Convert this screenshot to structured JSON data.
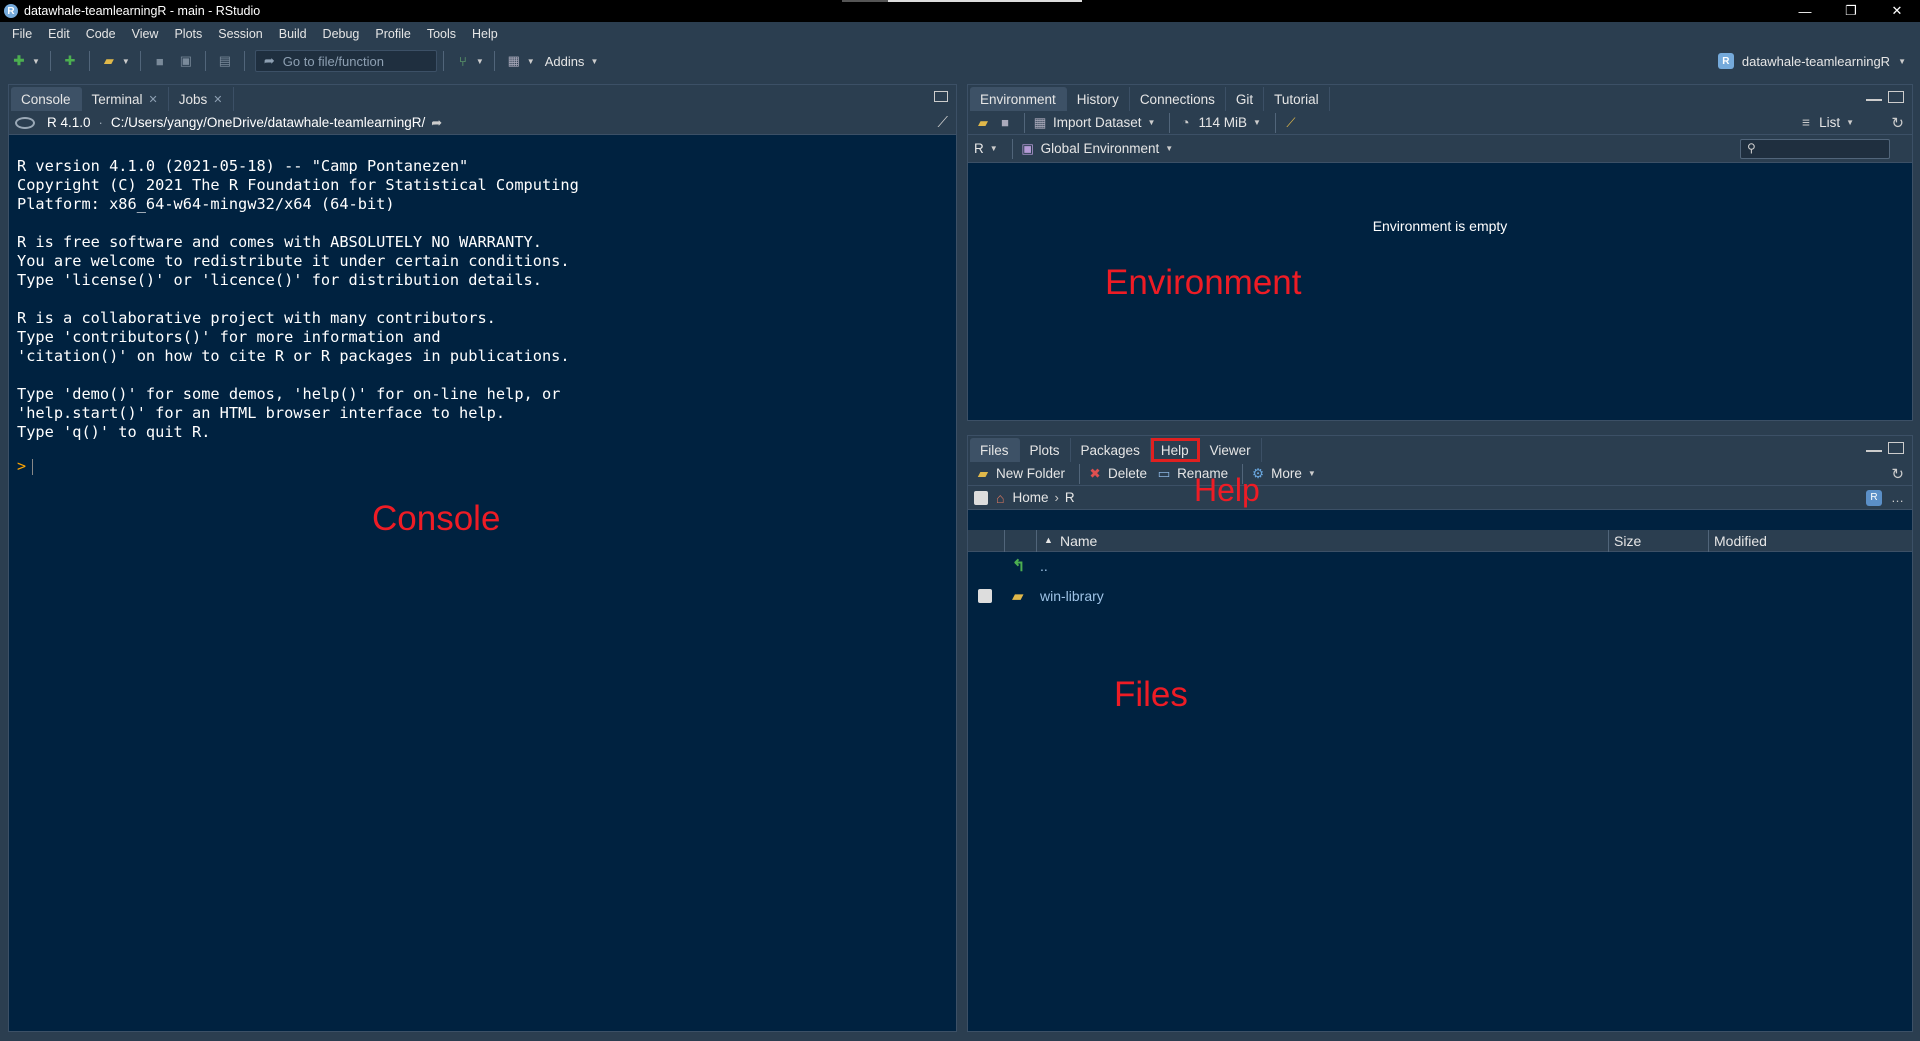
{
  "window": {
    "title": "datawhale-teamlearningR - main - RStudio",
    "controls": [
      "—",
      "❐",
      "✕"
    ]
  },
  "menu": [
    "File",
    "Edit",
    "Code",
    "View",
    "Plots",
    "Session",
    "Build",
    "Debug",
    "Profile",
    "Tools",
    "Help"
  ],
  "toolbar": {
    "goto_placeholder": "Go to file/function",
    "addins_label": "Addins",
    "project_label": "datawhale-teamlearningR"
  },
  "console_pane": {
    "tabs": [
      {
        "label": "Console",
        "active": true,
        "closable": false
      },
      {
        "label": "Terminal",
        "active": false,
        "closable": true
      },
      {
        "label": "Jobs",
        "active": false,
        "closable": true
      }
    ],
    "r_version": "R 4.1.0",
    "path": "C:/Users/yangy/OneDrive/datawhale-teamlearningR/",
    "output_lines": [
      "R version 4.1.0 (2021-05-18) -- \"Camp Pontanezen\"",
      "Copyright (C) 2021 The R Foundation for Statistical Computing",
      "Platform: x86_64-w64-mingw32/x64 (64-bit)",
      "",
      "R is free software and comes with ABSOLUTELY NO WARRANTY.",
      "You are welcome to redistribute it under certain conditions.",
      "Type 'license()' or 'licence()' for distribution details.",
      "",
      "R is a collaborative project with many contributors.",
      "Type 'contributors()' for more information and",
      "'citation()' on how to cite R or R packages in publications.",
      "",
      "Type 'demo()' for some demos, 'help()' for on-line help, or",
      "'help.start()' for an HTML browser interface to help.",
      "Type 'q()' to quit R."
    ],
    "prompt": ">",
    "annotation": "Console"
  },
  "env_pane": {
    "tabs": [
      {
        "label": "Environment",
        "active": true
      },
      {
        "label": "History",
        "active": false
      },
      {
        "label": "Connections",
        "active": false
      },
      {
        "label": "Git",
        "active": false
      },
      {
        "label": "Tutorial",
        "active": false
      }
    ],
    "import_label": "Import Dataset",
    "memory_label": "114 MiB",
    "list_label": "List",
    "lang_label": "R",
    "scope_label": "Global Environment",
    "empty_message": "Environment is empty",
    "annotation": "Environment"
  },
  "files_pane": {
    "tabs": [
      {
        "label": "Files",
        "active": true
      },
      {
        "label": "Plots",
        "active": false
      },
      {
        "label": "Packages",
        "active": false
      },
      {
        "label": "Help",
        "active": false,
        "highlighted": true
      },
      {
        "label": "Viewer",
        "active": false
      }
    ],
    "new_folder_label": "New Folder",
    "delete_label": "Delete",
    "rename_label": "Rename",
    "more_label": "More",
    "breadcrumb": {
      "home": "Home",
      "current": "R"
    },
    "columns": {
      "name": "Name",
      "size": "Size",
      "modified": "Modified"
    },
    "rows": [
      {
        "name": "..",
        "type": "up"
      },
      {
        "name": "win-library",
        "type": "folder"
      }
    ],
    "annotation_files": "Files",
    "annotation_help": "Help"
  },
  "colors": {
    "pane_bg": "#002240",
    "chrome_bg": "#2b3e50",
    "annotation_red": "#ee1c25",
    "prompt_orange": "#ffa500"
  }
}
